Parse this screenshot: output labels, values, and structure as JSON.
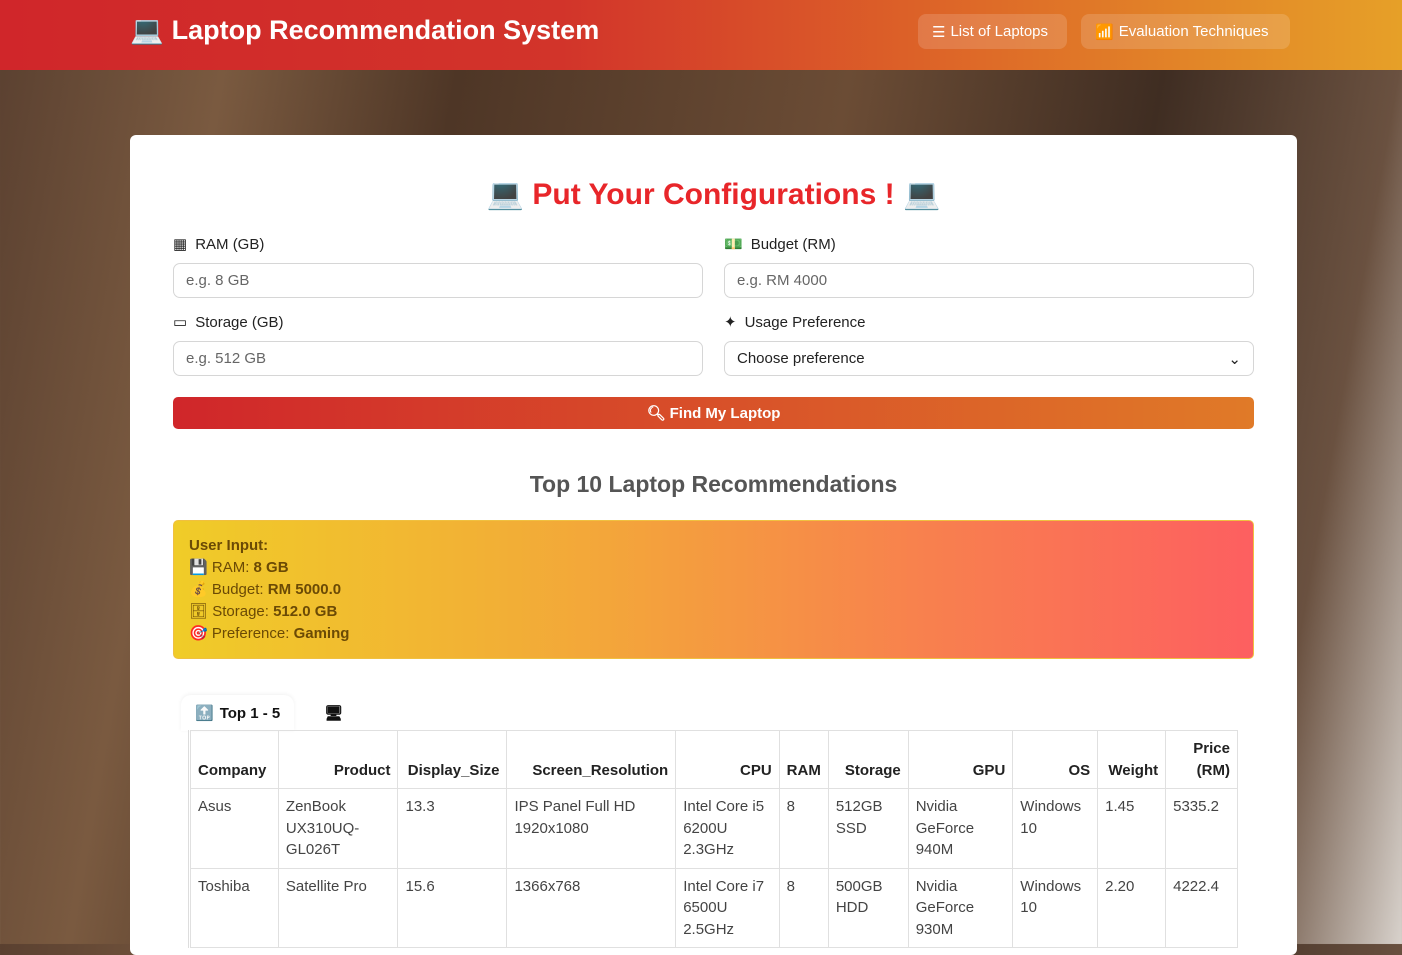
{
  "nav": {
    "brand": "Laptop Recommendation System",
    "links": [
      "List of Laptops",
      "Evaluation Techniques"
    ]
  },
  "form": {
    "title": "Put Your Configurations !",
    "ram_label": "RAM (GB)",
    "ram_placeholder": "e.g. 8 GB",
    "budget_label": "Budget (RM)",
    "budget_placeholder": "e.g. RM 4000",
    "storage_label": "Storage (GB)",
    "storage_placeholder": "e.g. 512 GB",
    "usage_label": "Usage Preference",
    "usage_value": "Choose preference",
    "submit": "Find My Laptop"
  },
  "results": {
    "title": "Top 10 Laptop Recommendations",
    "user_input": {
      "heading": "User Input:",
      "ram_label": "RAM: ",
      "ram": "8 GB",
      "budget_label": "Budget: ",
      "budget": "RM 5000.0",
      "storage_label": "Storage: ",
      "storage": "512.0 GB",
      "pref_label": "Preference: ",
      "pref": "Gaming"
    },
    "tabs": [
      "Top 1 - 5"
    ],
    "table": {
      "headers": [
        "Company",
        "Product",
        "Display_Size",
        "Screen_Resolution",
        "CPU",
        "RAM",
        "Storage",
        "GPU",
        "OS",
        "Weight",
        "Price (RM)"
      ],
      "rows": [
        [
          "Asus",
          "ZenBook UX310UQ-GL026T",
          "13.3",
          "IPS Panel Full HD 1920x1080",
          "Intel Core i5 6200U 2.3GHz",
          "8",
          "512GB SSD",
          "Nvidia GeForce 940M",
          "Windows 10",
          "1.45",
          "5335.2"
        ],
        [
          "Toshiba",
          "Satellite Pro",
          "15.6",
          "1366x768",
          "Intel Core i7 6500U 2.5GHz",
          "8",
          "500GB HDD",
          "Nvidia GeForce 930M",
          "Windows 10",
          "2.20",
          "4222.4"
        ]
      ]
    }
  }
}
